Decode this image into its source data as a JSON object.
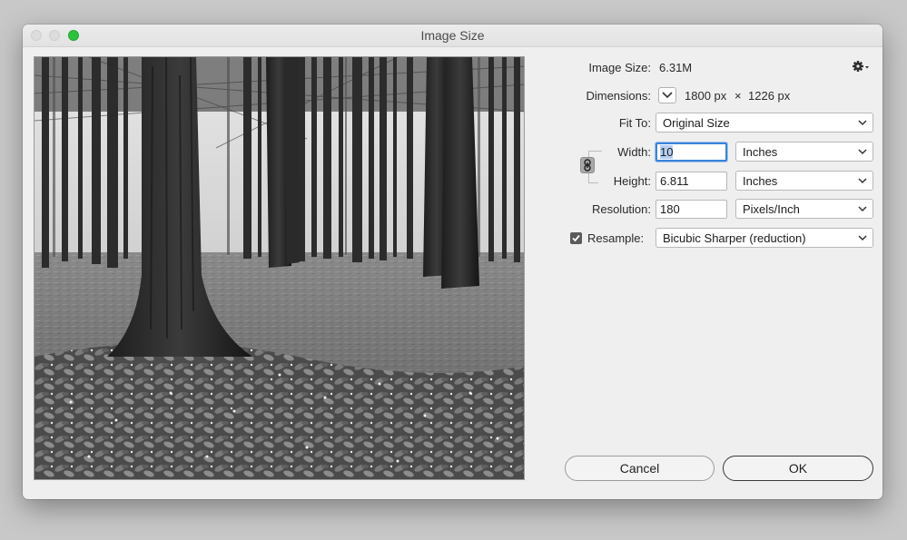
{
  "window": {
    "title": "Image Size"
  },
  "image_size": {
    "label": "Image Size:",
    "value": "6.31M"
  },
  "dimensions": {
    "label": "Dimensions:",
    "width": "1800 px",
    "times": "×",
    "height": "1226 px"
  },
  "fit_to": {
    "label": "Fit To:",
    "value": "Original Size"
  },
  "width": {
    "label": "Width:",
    "value": "10",
    "unit": "Inches"
  },
  "height": {
    "label": "Height:",
    "value": "6.811",
    "unit": "Inches"
  },
  "resolution": {
    "label": "Resolution:",
    "value": "180",
    "unit": "Pixels/Inch"
  },
  "resample": {
    "label": "Resample:",
    "checked": true,
    "value": "Bicubic Sharper (reduction)"
  },
  "buttons": {
    "cancel": "Cancel",
    "ok": "OK"
  },
  "colors": {
    "focus": "#3a84d8",
    "zoom_button": "#2bc23f"
  },
  "icons": {
    "settings": "gear-icon",
    "link": "chain-link-icon",
    "dimensions_menu": "chevron-down-icon"
  }
}
